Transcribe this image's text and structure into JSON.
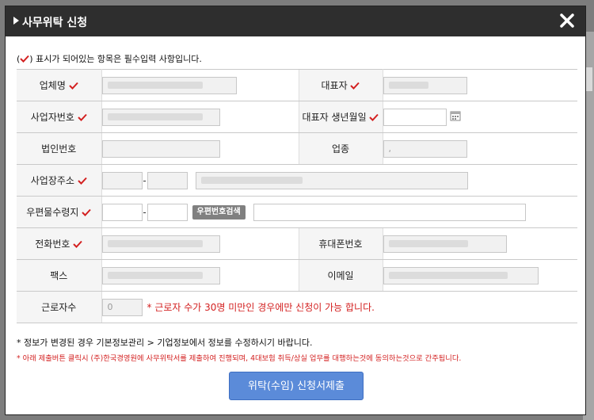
{
  "modal": {
    "title": "사무위탁 신청",
    "required_note_prefix": "(",
    "required_note_suffix": ") 표시가 되어있는 항목은 필수입력 사항입니다."
  },
  "fields": {
    "company_name": {
      "label": "업체명"
    },
    "representative": {
      "label": "대표자"
    },
    "business_number": {
      "label": "사업자번호"
    },
    "rep_birthdate": {
      "label": "대표자 생년월일",
      "value": ""
    },
    "corp_number": {
      "label": "법인번호"
    },
    "business_type": {
      "label": "업종",
      "value": ","
    },
    "address": {
      "label": "사업장주소"
    },
    "postal_receiver": {
      "label": "우편물수령지",
      "zip_button": "우편번호검색"
    },
    "phone": {
      "label": "전화번호"
    },
    "mobile": {
      "label": "휴대폰번호"
    },
    "fax": {
      "label": "팩스"
    },
    "email": {
      "label": "이메일"
    },
    "workers": {
      "label": "근로자수",
      "value": "0",
      "warning": "* 근로자 수가 30명 미만인 경우에만 신청이 가능 합니다."
    }
  },
  "notes": {
    "info": "* 정보가 변경된 경우 기본정보관리 > 기업정보에서 정보를 수정하시기 바랍니다.",
    "consent": "* 아래 제출버튼 클릭시 (주)한국경영원에 사무위탁서를 제출하여 진행되며, 4대보험 취득/상실 업무를 대행하는것에 동의하는것으로 간주됩니다."
  },
  "submit_label": "위탁(수임) 신청서제출",
  "icons": {
    "close": "close-icon",
    "calendar": "calendar-icon",
    "check": "checkmark-icon"
  },
  "colors": {
    "required": "#d32020",
    "submit": "#5b8bd9",
    "titlebar": "#2e2e2e"
  }
}
